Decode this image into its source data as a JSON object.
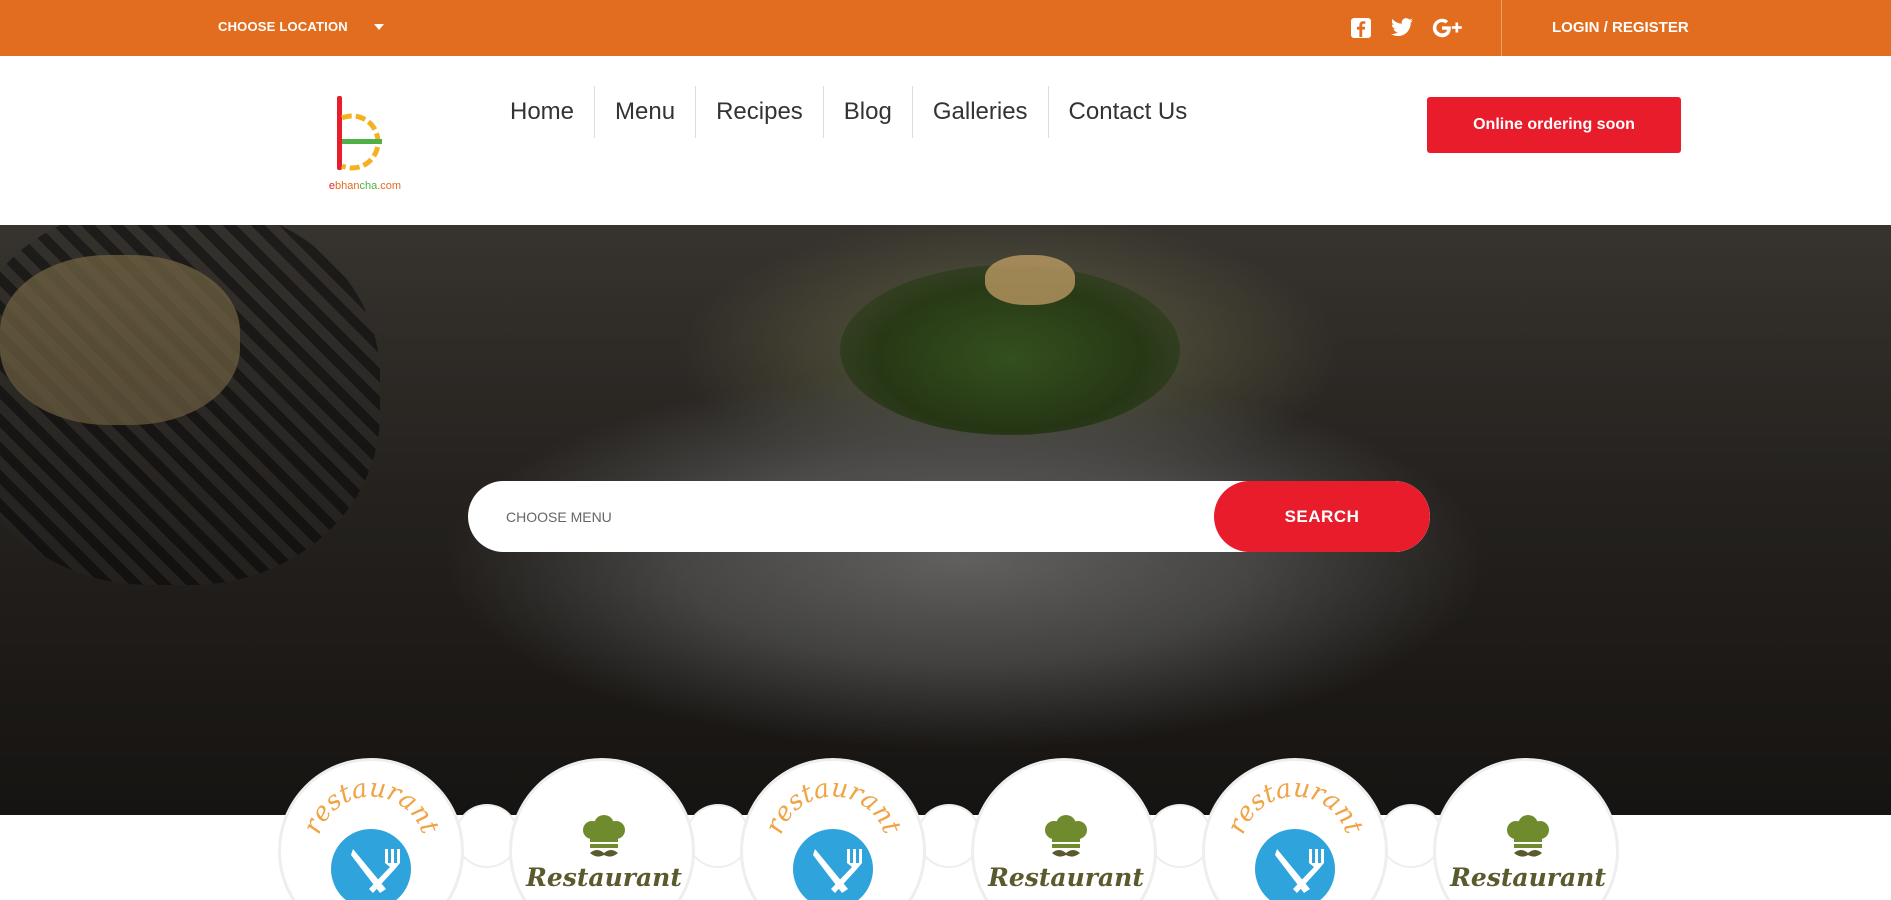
{
  "topbar": {
    "location_label": "CHOOSE LOCATION",
    "login_label": "LOGIN / REGISTER",
    "socials": [
      "facebook-icon",
      "twitter-icon",
      "google-plus-icon"
    ]
  },
  "header": {
    "logo_text": "ebhancha.com",
    "nav": [
      {
        "label": "Home"
      },
      {
        "label": "Menu"
      },
      {
        "label": "Recipes"
      },
      {
        "label": "Blog"
      },
      {
        "label": "Galleries"
      },
      {
        "label": "Contact Us"
      }
    ],
    "order_button": "Online ordering soon"
  },
  "hero": {
    "search_placeholder": "CHOOSE MENU",
    "search_button": "SEARCH"
  },
  "badges": [
    {
      "style": "blue",
      "text": "restaurant"
    },
    {
      "style": "chef",
      "text": "Restaurant"
    },
    {
      "style": "blue",
      "text": "restaurant"
    },
    {
      "style": "chef",
      "text": "Restaurant"
    },
    {
      "style": "blue",
      "text": "restaurant"
    },
    {
      "style": "chef",
      "text": "Restaurant"
    }
  ],
  "colors": {
    "topbar": "#e26d1f",
    "accent_red": "#e81c2a",
    "badge_blue": "#2ea3dc",
    "badge_orange": "#f0a445",
    "badge_green": "#6f8b2e",
    "badge_olive": "#5a5a2e"
  }
}
